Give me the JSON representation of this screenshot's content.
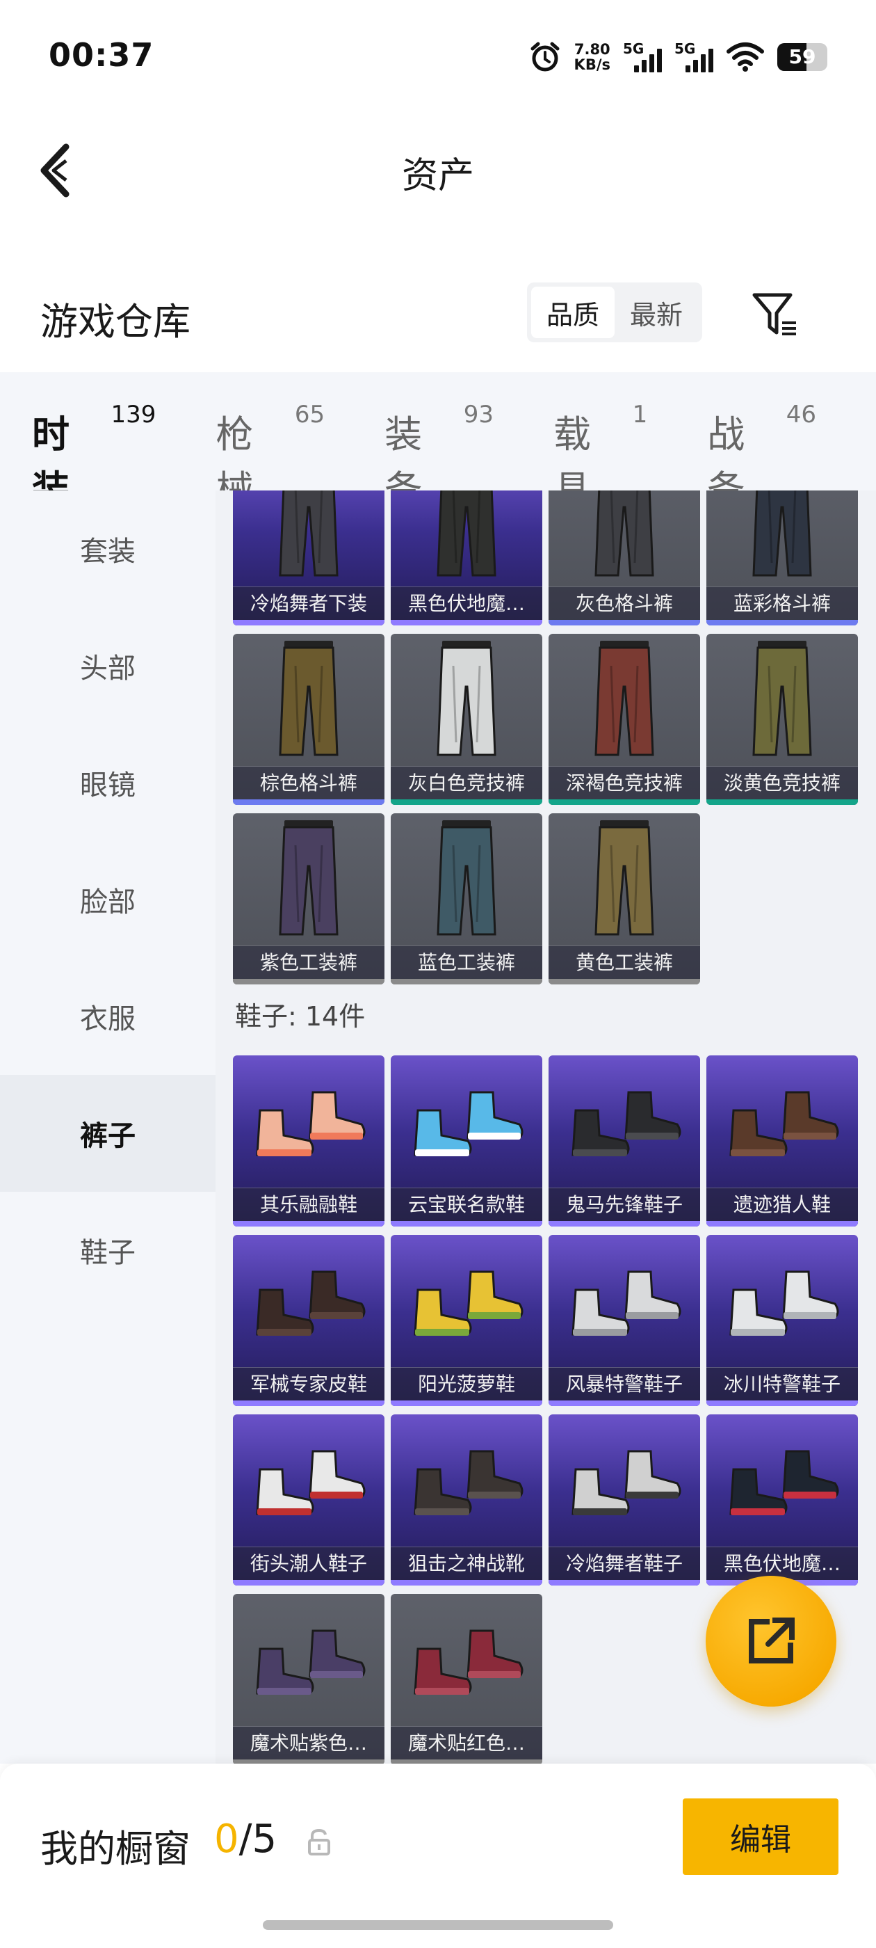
{
  "status_bar": {
    "time": "00:37",
    "net_speed_value": "7.80",
    "net_speed_unit": "KB/s",
    "signal1_label": "5G",
    "signal2_label": "5G",
    "battery_level": "59"
  },
  "nav": {
    "title": "资产",
    "back_icon": "chevron-left-icon"
  },
  "warehouse": {
    "title": "游戏仓库",
    "sort_options": [
      "品质",
      "最新"
    ],
    "sort_selected": "品质",
    "filter_icon": "filter-icon"
  },
  "categories": [
    {
      "name": "时装",
      "count": "139",
      "active": true
    },
    {
      "name": "枪械",
      "count": "65",
      "active": false
    },
    {
      "name": "装备",
      "count": "93",
      "active": false
    },
    {
      "name": "载具",
      "count": "1",
      "active": false
    },
    {
      "name": "战备",
      "count": "46",
      "active": false
    }
  ],
  "side_menu": [
    {
      "label": "套装",
      "active": false
    },
    {
      "label": "头部",
      "active": false
    },
    {
      "label": "眼镜",
      "active": false
    },
    {
      "label": "脸部",
      "active": false
    },
    {
      "label": "衣服",
      "active": false
    },
    {
      "label": "裤子",
      "active": true
    },
    {
      "label": "鞋子",
      "active": false
    }
  ],
  "pants_items": [
    {
      "name": "冷焰舞者下装",
      "bg": "purple",
      "rarity": "#8f7bff",
      "art": "pants",
      "color": "#3f3f45"
    },
    {
      "name": "黑色伏地魔…",
      "bg": "purple",
      "rarity": "#8f7bff",
      "art": "pants",
      "color": "#2f302e"
    },
    {
      "name": "灰色格斗裤",
      "bg": "gray",
      "rarity": "#6d7bf0",
      "art": "pants",
      "color": "#3e3f44"
    },
    {
      "name": "蓝彩格斗裤",
      "bg": "gray",
      "rarity": "#6d7bf0",
      "art": "pants",
      "color": "#2e3542"
    },
    {
      "name": "棕色格斗裤",
      "bg": "gray",
      "rarity": "#6d7bf0",
      "art": "pants",
      "color": "#6b5a2e"
    },
    {
      "name": "灰白色竞技裤",
      "bg": "gray",
      "rarity": "#14a58a",
      "art": "pants",
      "color": "#d6d8d8"
    },
    {
      "name": "深褐色竞技裤",
      "bg": "gray",
      "rarity": "#14a58a",
      "art": "pants",
      "color": "#7a3a32"
    },
    {
      "name": "淡黄色竞技裤",
      "bg": "gray",
      "rarity": "#14a58a",
      "art": "pants",
      "color": "#6d6a3a"
    },
    {
      "name": "紫色工装裤",
      "bg": "gray",
      "rarity": "#8a8a8a",
      "art": "pants",
      "color": "#4a4060"
    },
    {
      "name": "蓝色工装裤",
      "bg": "gray",
      "rarity": "#8a8a8a",
      "art": "pants",
      "color": "#3f5a66"
    },
    {
      "name": "黄色工装裤",
      "bg": "gray",
      "rarity": "#8a8a8a",
      "art": "pants",
      "color": "#7a6a3e"
    }
  ],
  "shoes_section": {
    "title": "鞋子: 14件"
  },
  "shoe_items": [
    {
      "name": "其乐融融鞋",
      "bg": "purple",
      "rarity": "#8f7bff",
      "art": "shoe",
      "color": "#f1b49a",
      "accent": "#f07a5a"
    },
    {
      "name": "云宝联名款鞋",
      "bg": "purple",
      "rarity": "#8f7bff",
      "art": "shoe",
      "color": "#58b9e8",
      "accent": "#ffffff"
    },
    {
      "name": "鬼马先锋鞋子",
      "bg": "purple",
      "rarity": "#8f7bff",
      "art": "shoe",
      "color": "#2a2b2e",
      "accent": "#4a4b4f"
    },
    {
      "name": "遗迹猎人鞋",
      "bg": "purple",
      "rarity": "#8f7bff",
      "art": "shoe",
      "color": "#5a3a2a",
      "accent": "#7a5240"
    },
    {
      "name": "军械专家皮鞋",
      "bg": "purple",
      "rarity": "#8f7bff",
      "art": "shoe",
      "color": "#3a2a26",
      "accent": "#5a423a"
    },
    {
      "name": "阳光菠萝鞋",
      "bg": "purple",
      "rarity": "#8f7bff",
      "art": "shoe",
      "color": "#e7c234",
      "accent": "#7aa83a"
    },
    {
      "name": "风暴特警鞋子",
      "bg": "purple",
      "rarity": "#8f7bff",
      "art": "shoe",
      "color": "#d9dadc",
      "accent": "#9a9ca0"
    },
    {
      "name": "冰川特警鞋子",
      "bg": "purple",
      "rarity": "#8f7bff",
      "art": "shoe",
      "color": "#e4e6e8",
      "accent": "#b0b4b8"
    },
    {
      "name": "街头潮人鞋子",
      "bg": "purple",
      "rarity": "#8f7bff",
      "art": "shoe",
      "color": "#e8e8e8",
      "accent": "#c03030"
    },
    {
      "name": "狙击之神战靴",
      "bg": "purple",
      "rarity": "#8f7bff",
      "art": "shoe",
      "color": "#3a3432",
      "accent": "#5a524e"
    },
    {
      "name": "冷焰舞者鞋子",
      "bg": "purple",
      "rarity": "#8f7bff",
      "art": "shoe",
      "color": "#d0d0d0",
      "accent": "#3a3a3a"
    },
    {
      "name": "黑色伏地魔…",
      "bg": "purple",
      "rarity": "#8f7bff",
      "art": "shoe",
      "color": "#1e2530",
      "accent": "#c83040"
    },
    {
      "name": "魔术贴紫色…",
      "bg": "gray",
      "rarity": "#8a8a8a",
      "art": "shoe",
      "color": "#4a3e66",
      "accent": "#6a5a8a"
    },
    {
      "name": "魔术贴红色…",
      "bg": "gray",
      "rarity": "#8a8a8a",
      "art": "shoe",
      "color": "#8a2a3a",
      "accent": "#b04a5a"
    }
  ],
  "fab": {
    "icon": "share-external-icon"
  },
  "bottom_bar": {
    "showcase_label": "我的橱窗",
    "showcase_current": "0",
    "showcase_total": "/5",
    "lock_icon": "lock-icon",
    "edit_label": "编辑"
  },
  "colors": {
    "accent": "#f5b400",
    "purple_rarity": "#8f7bff",
    "teal_rarity": "#14a58a"
  }
}
